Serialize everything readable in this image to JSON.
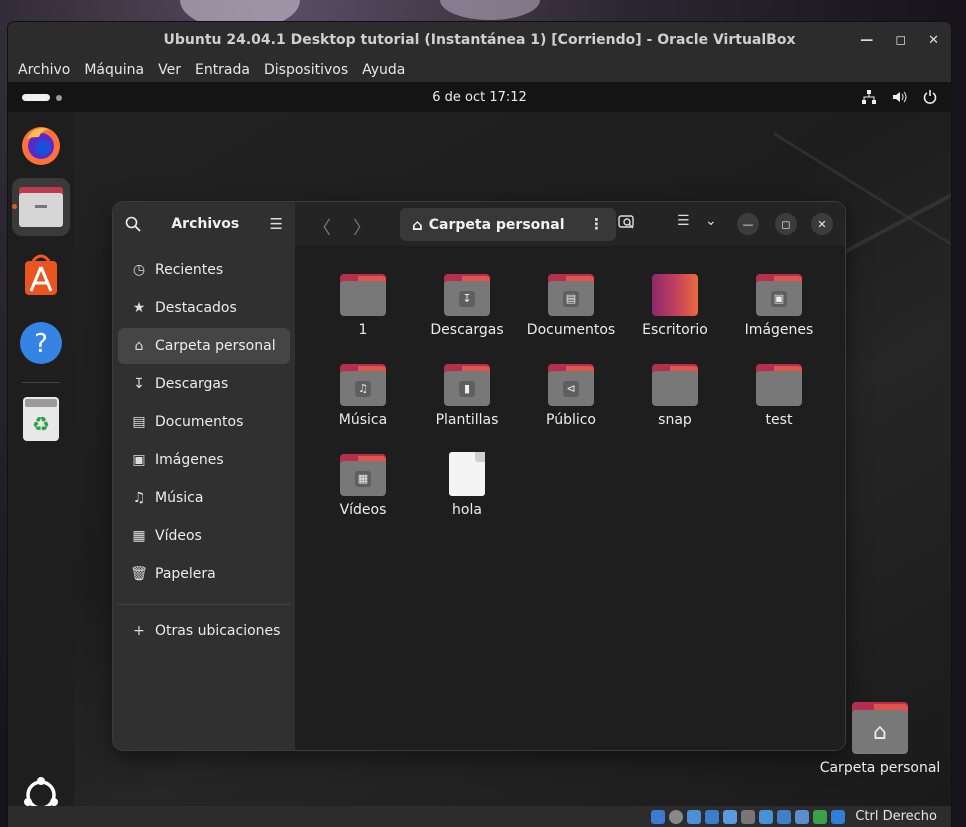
{
  "vbox": {
    "title": "Ubuntu 24.04.1 Desktop tutorial (Instantánea 1) [Corriendo] - Oracle VirtualBox",
    "menu": [
      "Archivo",
      "Máquina",
      "Ver",
      "Entrada",
      "Dispositivos",
      "Ayuda"
    ],
    "host_key": "Ctrl Derecho"
  },
  "topbar": {
    "datetime": "6 de oct  17:12"
  },
  "files": {
    "app_title": "Archivos",
    "path": "Carpeta personal",
    "sidebar": [
      {
        "label": "Recientes",
        "icon": "clock-icon"
      },
      {
        "label": "Destacados",
        "icon": "star-icon"
      },
      {
        "label": "Carpeta personal",
        "icon": "home-icon",
        "selected": true
      },
      {
        "label": "Descargas",
        "icon": "download-icon"
      },
      {
        "label": "Documentos",
        "icon": "document-icon"
      },
      {
        "label": "Imágenes",
        "icon": "image-icon"
      },
      {
        "label": "Música",
        "icon": "music-icon"
      },
      {
        "label": "Vídeos",
        "icon": "video-icon"
      },
      {
        "label": "Papelera",
        "icon": "trash-icon"
      }
    ],
    "other_locations": "Otras ubicaciones",
    "items": [
      {
        "label": "1",
        "type": "folder"
      },
      {
        "label": "Descargas",
        "type": "folder",
        "emblem": "download-icon"
      },
      {
        "label": "Documentos",
        "type": "folder",
        "emblem": "document-icon"
      },
      {
        "label": "Escritorio",
        "type": "desktop-folder"
      },
      {
        "label": "Imágenes",
        "type": "folder",
        "emblem": "image-icon"
      },
      {
        "label": "Música",
        "type": "folder",
        "emblem": "music-icon"
      },
      {
        "label": "Plantillas",
        "type": "folder",
        "emblem": "template-icon"
      },
      {
        "label": "Público",
        "type": "folder",
        "emblem": "share-icon"
      },
      {
        "label": "snap",
        "type": "folder"
      },
      {
        "label": "test",
        "type": "folder"
      },
      {
        "label": "Vídeos",
        "type": "folder",
        "emblem": "video-icon"
      },
      {
        "label": "hola",
        "type": "file"
      }
    ]
  },
  "desktop": {
    "home_label": "Carpeta personal"
  }
}
